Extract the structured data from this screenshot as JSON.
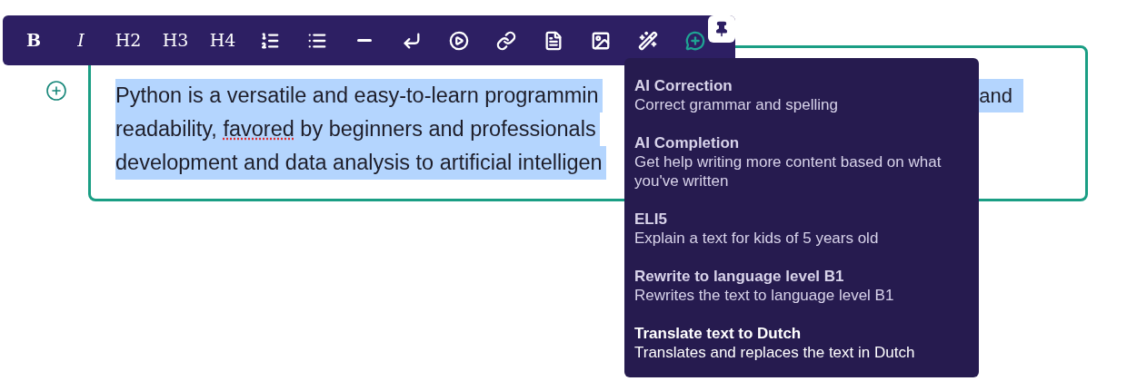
{
  "toolbar": {
    "text_buttons": [
      {
        "label": "B",
        "active": false
      },
      {
        "label": "I",
        "active": false
      },
      {
        "label": "H2",
        "active": false
      },
      {
        "label": "H3",
        "active": false
      },
      {
        "label": "H4",
        "active": false
      }
    ],
    "icon_buttons": [
      {
        "active": false
      },
      {
        "active": false
      },
      {
        "active": false
      },
      {
        "active": false
      },
      {
        "active": false
      },
      {
        "active": false
      },
      {
        "active": false
      },
      {
        "active": false
      },
      {
        "active": false
      },
      {
        "active": true
      }
    ],
    "pin_button": {
      "pinned": true
    }
  },
  "editor": {
    "focused": true,
    "lines": [
      {
        "segments": [
          {
            "text": "Python is a versatile and easy-to-learn programmin",
            "misspelled": false
          }
        ],
        "tail": "and"
      },
      {
        "segments": [
          {
            "text": "readability, ",
            "misspelled": false
          },
          {
            "text": "favored",
            "misspelled": true
          },
          {
            "text": " by beginners and professionals",
            "misspelled": false
          }
        ]
      },
      {
        "segments": [
          {
            "text": "development and data analysis to artificial intelligen",
            "misspelled": false
          }
        ]
      }
    ]
  },
  "ai_menu": {
    "items": [
      {
        "title": "AI Correction",
        "description": "Correct grammar and spelling",
        "selected": false
      },
      {
        "title": "AI Completion",
        "description": "Get help writing more content based on what you've written",
        "selected": false
      },
      {
        "title": "ELI5",
        "description": "Explain a text for kids of 5 years old",
        "selected": false
      },
      {
        "title": "Rewrite to language level B1",
        "description": "Rewrites the text to language level B1",
        "selected": false
      },
      {
        "title": "Translate text to Dutch",
        "description": "Translates and replaces the text in Dutch",
        "selected": true
      }
    ]
  }
}
